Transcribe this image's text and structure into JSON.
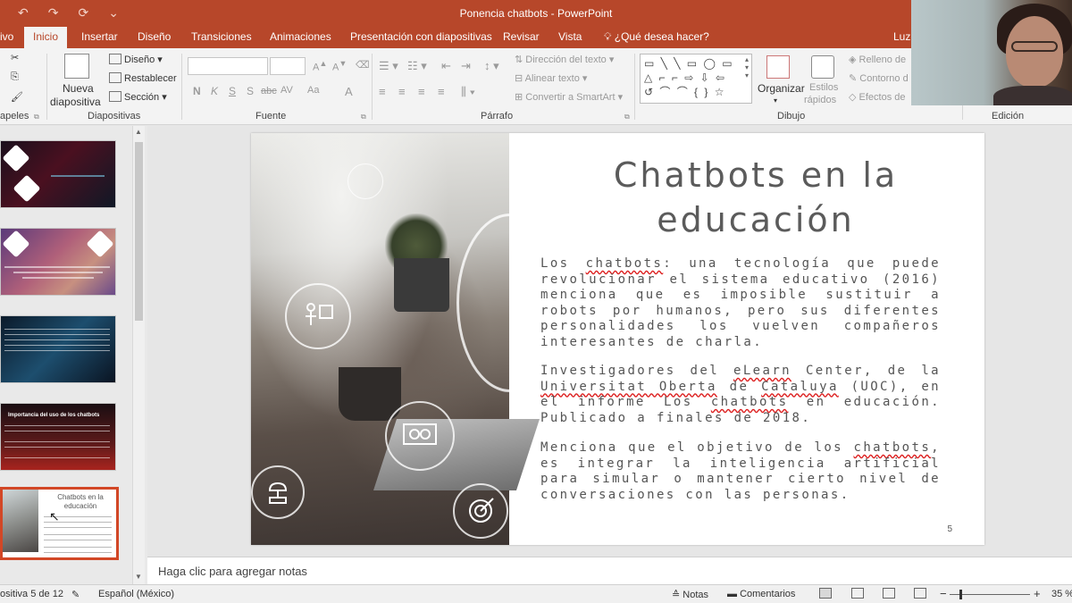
{
  "titlebar": {
    "title": "Ponencia chatbots - PowerPoint",
    "qat": [
      "↶",
      "↷",
      "⟳",
      "⌄"
    ]
  },
  "tabs": [
    "ivo",
    "Inicio",
    "Insertar",
    "Diseño",
    "Transiciones",
    "Animaciones",
    "Presentación con diapositivas",
    "Revisar",
    "Vista"
  ],
  "tell_me": "¿Qué desea hacer?",
  "user": "Luz",
  "ribbon": {
    "groups": {
      "clipboard": "apeles",
      "slides": "Diapositivas",
      "font": "Fuente",
      "paragraph": "Párrafo",
      "drawing": "Dibujo",
      "editing": "Edición"
    },
    "slides": {
      "new_line1": "Nueva",
      "new_line2": "diapositiva",
      "layout": "Diseño",
      "reset": "Restablecer",
      "section": "Sección"
    },
    "font": {
      "bold": "N",
      "italic": "K",
      "underline": "S",
      "strike": "S",
      "strike2": "abc",
      "spacing": "AV",
      "case": "Aa",
      "color": "A"
    },
    "paragraph": {
      "text_direction": "Dirección del texto",
      "align_text": "Alinear texto",
      "smartart": "Convertir a SmartArt"
    },
    "drawing": {
      "arrange": "Organizar",
      "styles_line1": "Estilos",
      "styles_line2": "rápidos",
      "fill": "Relleno de",
      "outline": "Contorno d",
      "effects": "Efectos de"
    }
  },
  "thumbnails": {
    "slide3_title": "Importancia del uso de los    chatbots",
    "slide5_title": "Chatbots  en la educación"
  },
  "slide": {
    "title": "Chatbots en la educación",
    "p1": {
      "a": "Los ",
      "w": "chatbots",
      "b": ": una tecnología que puede revolucionar el sistema educativo (2016) menciona que es imposible sustituir a robots por humanos, pero sus diferentes personalidades los vuelven compañeros interesantes de charla."
    },
    "p2": {
      "a": "Investigadores del ",
      "w1": "eLearn",
      "b": " Center, de la ",
      "w2": "Universitat Oberta",
      "c": " de ",
      "w3": "Cataluya",
      "d": " (UOC), en el informe Los ",
      "w4": "chatbots",
      "e": " en educación. Publicado a finales de 2018."
    },
    "p3": {
      "a": "Menciona que el objetivo de los ",
      "w": "chatbots",
      "b": ", es integrar la inteligencia artificial para simular o mantener cierto nivel de conversaciones con las personas."
    },
    "number": "5"
  },
  "notes_placeholder": "Haga clic para agregar notas",
  "status": {
    "slide_counter": "ositiva 5 de 12",
    "language": "Español (México)",
    "notes": "Notas",
    "comments": "Comentarios",
    "zoom": "35 %",
    "minus": "−",
    "plus": "+"
  }
}
